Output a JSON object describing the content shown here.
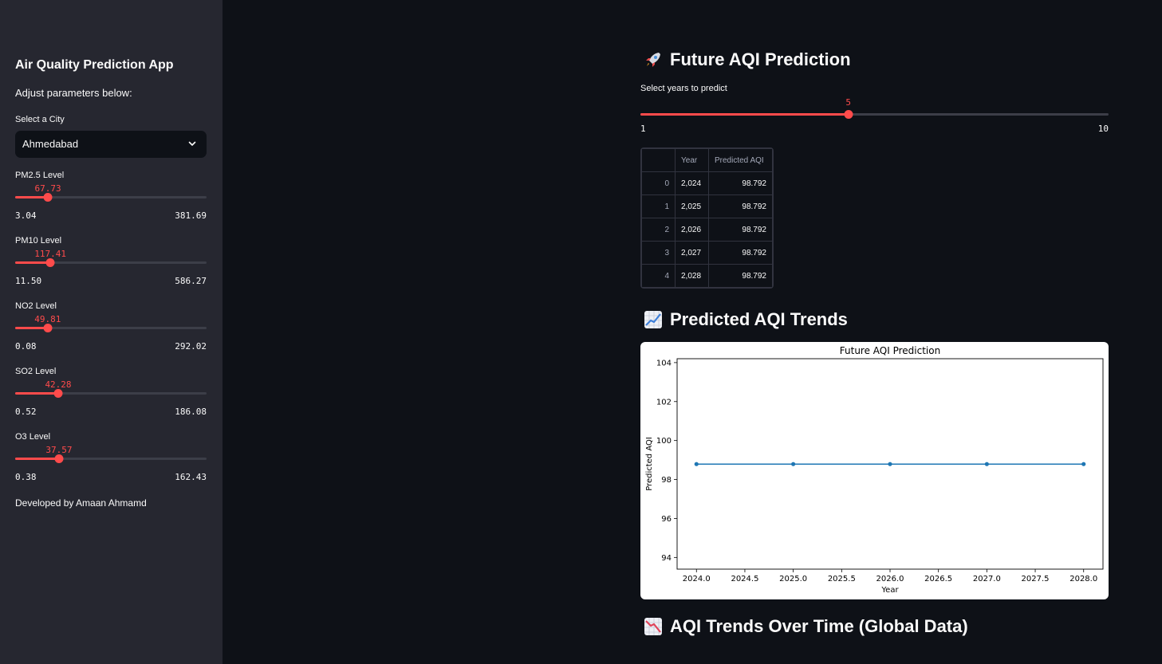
{
  "sidebar": {
    "title": "Air Quality Prediction App",
    "subtitle": "Adjust parameters below:",
    "city_label": "Select a City",
    "city_value": "Ahmedabad",
    "sliders": [
      {
        "label": "PM2.5 Level",
        "value": "67.73",
        "min": "3.04",
        "max": "381.69",
        "fraction": 0.171
      },
      {
        "label": "PM10 Level",
        "value": "117.41",
        "min": "11.50",
        "max": "586.27",
        "fraction": 0.184
      },
      {
        "label": "NO2 Level",
        "value": "49.81",
        "min": "0.08",
        "max": "292.02",
        "fraction": 0.17
      },
      {
        "label": "SO2 Level",
        "value": "42.28",
        "min": "0.52",
        "max": "186.08",
        "fraction": 0.225
      },
      {
        "label": "O3 Level",
        "value": "37.57",
        "min": "0.38",
        "max": "162.43",
        "fraction": 0.229
      }
    ],
    "footer": "Developed by Amaan Ahmamd"
  },
  "main": {
    "section1_title": "Future AQI Prediction",
    "section1_icon": "rocket-icon",
    "years_label": "Select years to predict",
    "years_value": "5",
    "years_min": "1",
    "years_max": "10",
    "years_fraction": 0.444,
    "table": {
      "columns": [
        "",
        "Year",
        "Predicted AQI"
      ],
      "rows": [
        [
          "0",
          "2,024",
          "98.792"
        ],
        [
          "1",
          "2,025",
          "98.792"
        ],
        [
          "2",
          "2,026",
          "98.792"
        ],
        [
          "3",
          "2,027",
          "98.792"
        ],
        [
          "4",
          "2,028",
          "98.792"
        ]
      ]
    },
    "section2_title": "Predicted AQI Trends",
    "section2_icon": "chart-increasing-icon",
    "section3_title": "AQI Trends Over Time (Global Data)",
    "section3_icon": "chart-decreasing-icon"
  },
  "chart_data": {
    "type": "line",
    "title": "Future AQI Prediction",
    "xlabel": "Year",
    "ylabel": "Predicted AQI",
    "x": [
      2024,
      2025,
      2026,
      2027,
      2028
    ],
    "series": [
      {
        "values": [
          98.792,
          98.792,
          98.792,
          98.792,
          98.792
        ],
        "color": "#1f77b4"
      }
    ],
    "xticks": [
      "2024.0",
      "2024.5",
      "2025.0",
      "2025.5",
      "2026.0",
      "2026.5",
      "2027.0",
      "2027.5",
      "2028.0"
    ],
    "yticks": [
      "94",
      "96",
      "98",
      "100",
      "102",
      "104"
    ],
    "xlim": [
      2023.8,
      2028.2
    ],
    "ylim": [
      93.4,
      104.2
    ],
    "grid": false
  },
  "colors": {
    "accent": "#ff4b4b",
    "sidebar_bg": "#262730",
    "main_bg": "#0e1117"
  }
}
